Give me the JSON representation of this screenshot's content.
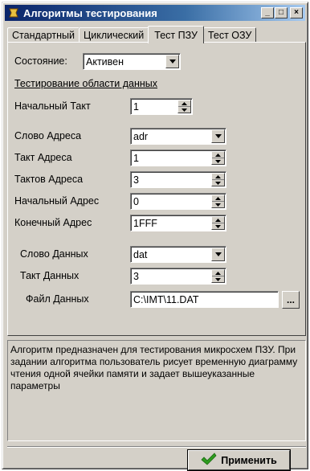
{
  "window": {
    "title": "Алгоритмы тестирования",
    "minimize_glyph": "_",
    "maximize_glyph": "□",
    "close_glyph": "×"
  },
  "tabs": [
    {
      "label": "Стандартный",
      "active": false
    },
    {
      "label": "Циклический",
      "active": false
    },
    {
      "label": "Тест ПЗУ",
      "active": true
    },
    {
      "label": "Тест ОЗУ",
      "active": false
    }
  ],
  "form": {
    "state_label": "Состояние:",
    "state_value": "Активен",
    "section_title": "Тестирование области данных",
    "start_tact_label": "Начальный Такт",
    "start_tact_value": "1",
    "addr_word_label": "Слово Адреса",
    "addr_word_value": "adr",
    "addr_tact_label": "Такт Адреса",
    "addr_tact_value": "1",
    "addr_tacts_label": "Тактов Адреса",
    "addr_tacts_value": "3",
    "start_addr_label": "Начальный Адрес",
    "start_addr_value": "0",
    "end_addr_label": "Конечный Адрес",
    "end_addr_value": "1FFF",
    "data_word_label": "Слово Данных",
    "data_word_value": "dat",
    "data_tact_label": "Такт Данных",
    "data_tact_value": "3",
    "data_file_label": "Файл Данных",
    "data_file_value": "C:\\IMT\\11.DAT",
    "browse_label": "..."
  },
  "description": "Алгоритм предназначен для тестирования микросхем ПЗУ. При задании алгоритма пользователь рисует временную диаграмму чтения одной ячейки памяти и задает вышеуказанные параметры",
  "apply_label": "Применить",
  "icons": {
    "app": "app-icon",
    "dropdown": "chevron-down-icon",
    "spin": "spin-updown-icon",
    "apply": "checkmark-icon"
  },
  "colors": {
    "face": "#d4d0c8",
    "title_start": "#0a246a",
    "title_end": "#a6caf0",
    "checkmark": "#2e9b1f"
  }
}
